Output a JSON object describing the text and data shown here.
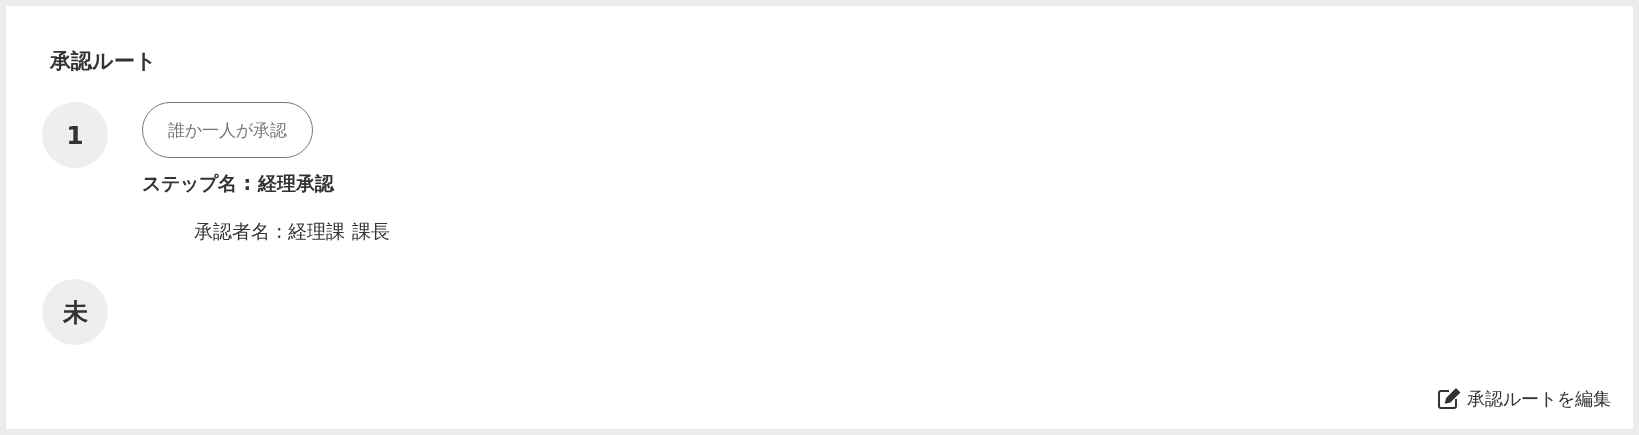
{
  "title": "承認ルート",
  "steps": [
    {
      "number": "1",
      "condition": "誰か一人が承認",
      "step_name": "ステップ名 : 経理承認",
      "approvers": [
        "承認者名 : 経理課 課長"
      ]
    },
    {
      "number": "未"
    }
  ],
  "edit_link": "承認ルートを編集"
}
